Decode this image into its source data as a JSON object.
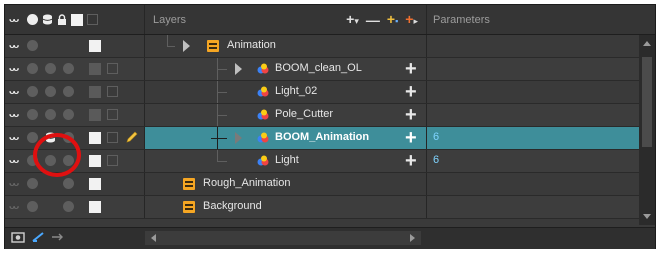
{
  "header": {
    "layers_label": "Layers",
    "parameters_label": "Parameters",
    "tools": [
      "add-layer",
      "remove-layer",
      "add-peg",
      "add-drawing"
    ]
  },
  "rows": [
    {
      "name": "Animation",
      "type": "group",
      "param": ""
    },
    {
      "name": "BOOM_clean_OL",
      "type": "drawing",
      "param": ""
    },
    {
      "name": "Light_02",
      "type": "drawing",
      "param": ""
    },
    {
      "name": "Pole_Cutter",
      "type": "drawing",
      "param": ""
    },
    {
      "name": "BOOM_Animation",
      "type": "drawing",
      "param": "6",
      "selected": true
    },
    {
      "name": "Light",
      "type": "drawing",
      "param": "6"
    },
    {
      "name": "Rough_Animation",
      "type": "group",
      "param": ""
    },
    {
      "name": "Background",
      "type": "group",
      "param": ""
    }
  ],
  "colors": {
    "panel_bg": "#3a3a3a",
    "selected_row": "#3e8e9a",
    "param_text": "#7fd4ff",
    "highlight": "#e01010",
    "group_icon": "#f5a623"
  }
}
